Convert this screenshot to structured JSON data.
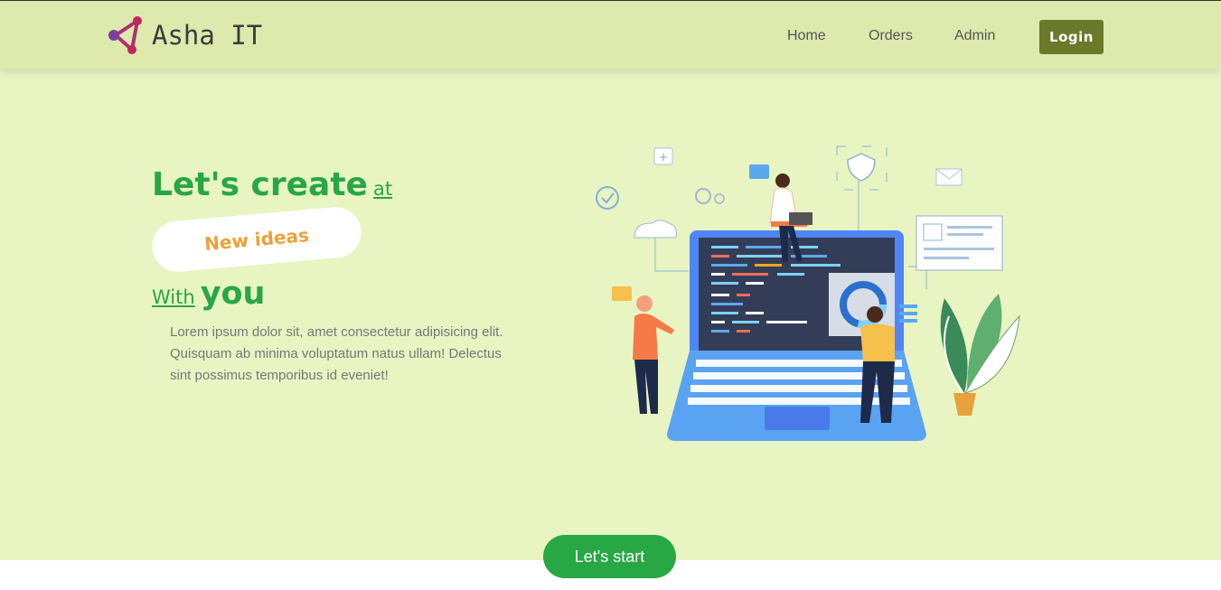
{
  "brand": {
    "name": "Asha IT",
    "logo_icon": "triangle-nodes-icon",
    "logo_color": "#b0306e"
  },
  "nav": {
    "home": "Home",
    "orders": "Orders",
    "admin": "Admin",
    "login": "Login"
  },
  "hero": {
    "line1_big": "Let's create",
    "line1_small": "at",
    "pill_text": "New ideas",
    "line3_small": "With",
    "line3_big": "you",
    "description": "Lorem ipsum dolor sit, amet consectetur adipisicing elit. Quisquam ab minima voluptatum natus ullam! Delectus sint possimus temporibus id eveniet!",
    "cta": "Let's start"
  },
  "colors": {
    "hero_bg": "#e8f4c2",
    "navbar_bg": "#dde9ad",
    "accent_green": "#28a745",
    "login_bg": "#6b7a2a",
    "pill_text": "#e9a23b"
  }
}
